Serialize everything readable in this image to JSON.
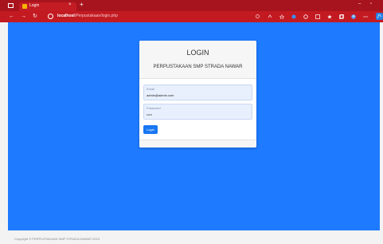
{
  "browser": {
    "tab_title": "Login",
    "tab_close": "×",
    "new_tab": "+",
    "url_host": "localhost",
    "url_path": "/Perpustakaan/login.php",
    "win_minimize": "–",
    "win_maximize": "▫"
  },
  "nav": {
    "back": "←",
    "forward": "→",
    "refresh": "↻"
  },
  "login": {
    "title": "LOGIN",
    "subtitle": "PERPUSTAKAAN SMP STRADA NAWAR",
    "email_label": "Email",
    "email_value": "admin@admin.com",
    "password_label": "Password",
    "password_value": "•••••",
    "button_label": "Login"
  },
  "footer": {
    "text": "Copyright © PERPUSTAKAAN SMP STRADA NAWAR 2023"
  },
  "colors": {
    "browser_chrome": "#c31a22",
    "page_background": "#1e7bff",
    "primary_button": "#1977f1",
    "input_background": "#e8f0fe"
  }
}
